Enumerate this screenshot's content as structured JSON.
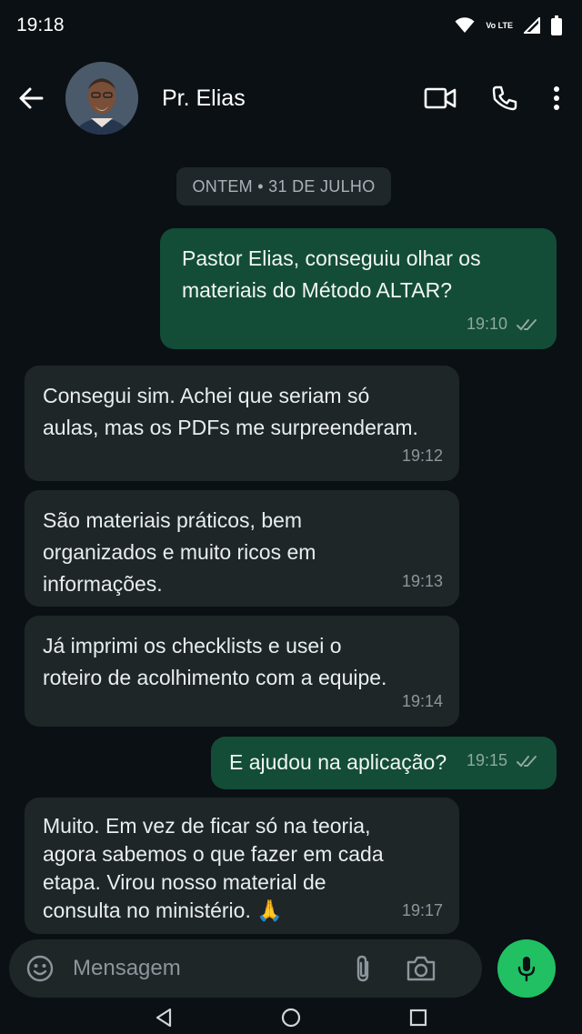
{
  "status_bar": {
    "time": "19:18",
    "network_label": "Vo LTE"
  },
  "header": {
    "contact_name": "Pr. Elias"
  },
  "chat": {
    "date_chip": "ONTEM • 31 DE JULHO",
    "messages": [
      {
        "direction": "out",
        "lines": [
          "Pastor Elias, conseguiu olhar os",
          "materiais do Método ALTAR?"
        ],
        "time": "19:10",
        "status": "read"
      },
      {
        "direction": "in",
        "lines": [
          "Consegui sim. Achei que seriam só",
          "aulas, mas os PDFs me surpreenderam."
        ],
        "time": "19:12"
      },
      {
        "direction": "in",
        "lines": [
          "São materiais práticos, bem",
          "organizados e muito ricos em",
          "informações."
        ],
        "time": "19:13"
      },
      {
        "direction": "in",
        "lines": [
          "Já imprimi os checklists e usei o",
          "roteiro de acolhimento com a equipe."
        ],
        "time": "19:14"
      },
      {
        "direction": "out",
        "lines": [
          "E ajudou na aplicação?"
        ],
        "time": "19:15",
        "status": "read"
      },
      {
        "direction": "in",
        "lines": [
          "Muito. Em vez de ficar só na teoria,",
          "agora sabemos o que fazer em cada",
          "etapa. Virou nosso material de",
          "consulta no ministério. 🙏"
        ],
        "time": "19:17"
      }
    ]
  },
  "composer": {
    "placeholder": "Mensagem"
  },
  "colors": {
    "outgoing_bubble": "#134d37",
    "incoming_bubble": "#1f2628",
    "accent": "#21c063",
    "background": "#0b1014"
  }
}
